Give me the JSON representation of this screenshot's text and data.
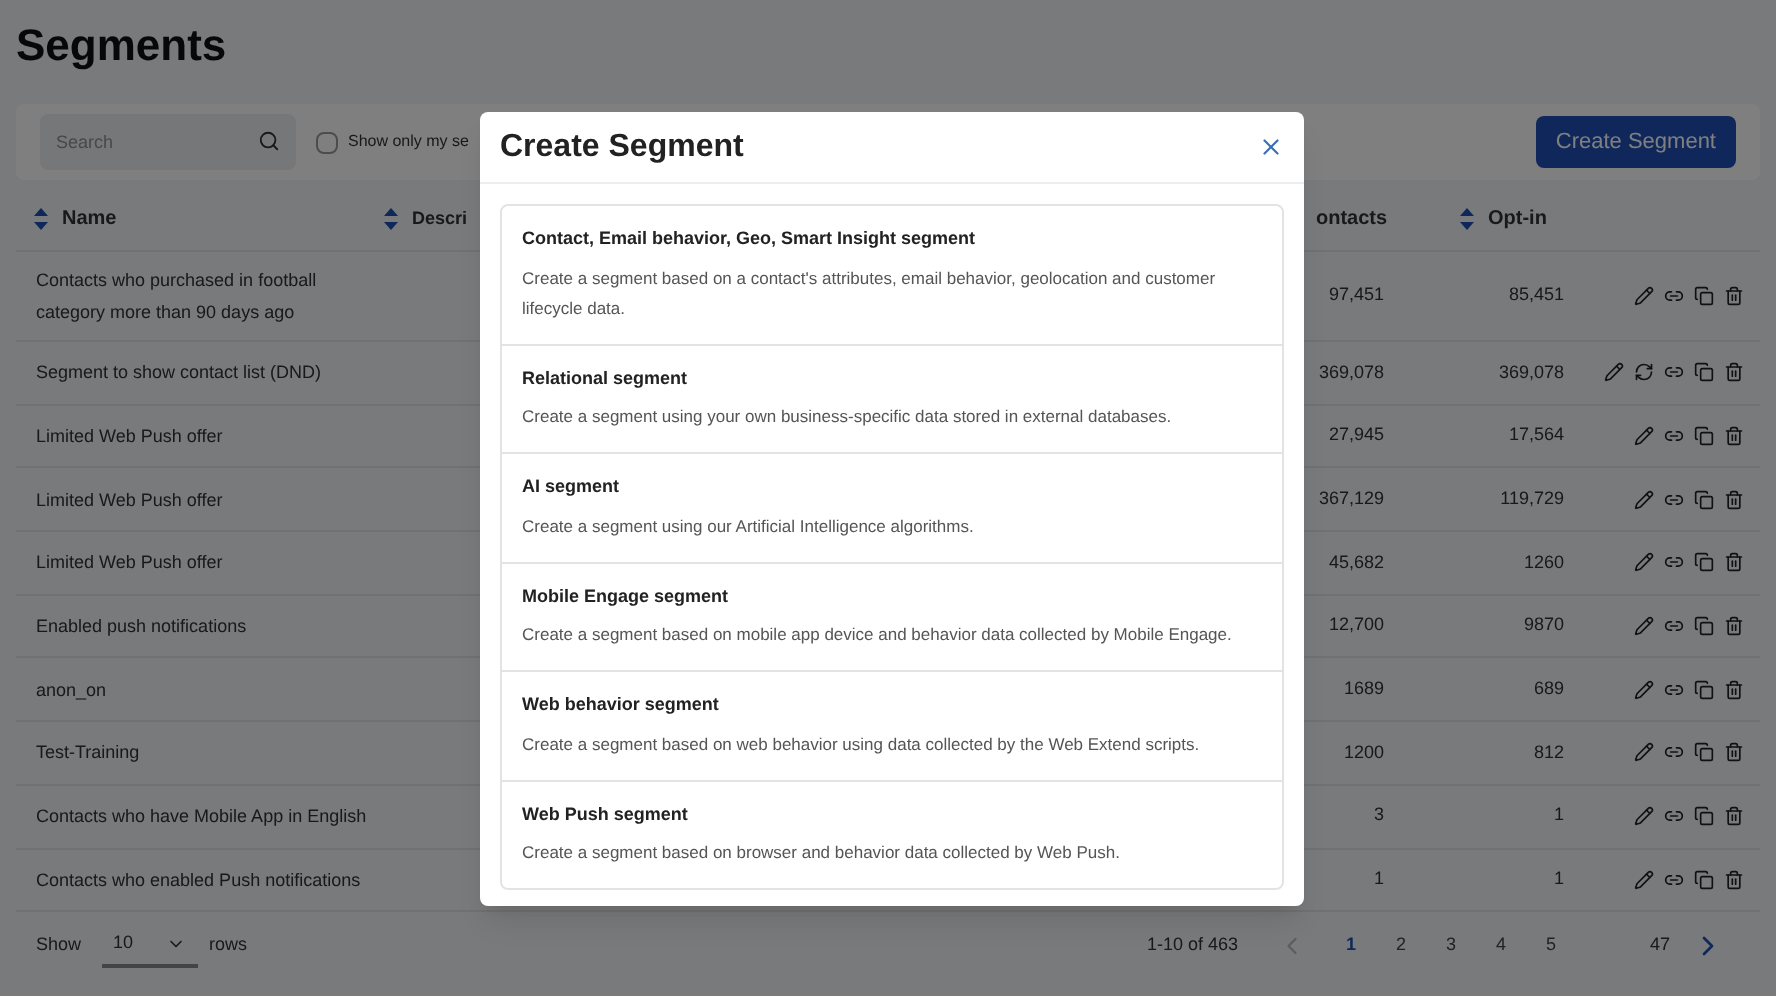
{
  "page": {
    "title": "Segments"
  },
  "toolbar": {
    "search": {
      "placeholder": "Search"
    },
    "filter": {
      "label": "Show only my se",
      "checked": false
    },
    "create_button": "Create Segment"
  },
  "table": {
    "columns": [
      {
        "label": "Name",
        "sortable": true
      },
      {
        "label": "Descri",
        "sortable": true
      },
      {
        "label": "ontacts"
      },
      {
        "label": "Opt-in",
        "sortable": true
      }
    ],
    "rows": [
      {
        "name": "Contacts who purchased in football category more than 90 days ago",
        "contacts": "97,451",
        "opt_in": "85,451",
        "refreshable": false
      },
      {
        "name": "Segment to show contact list (DND)",
        "contacts": "369,078",
        "opt_in": "369,078",
        "refreshable": true
      },
      {
        "name": "Limited Web Push offer",
        "contacts": "27,945",
        "opt_in": "17,564",
        "refreshable": false
      },
      {
        "name": "Limited Web Push offer",
        "contacts": "367,129",
        "opt_in": "119,729",
        "refreshable": false
      },
      {
        "name": "Limited Web Push offer",
        "contacts": "45,682",
        "opt_in": "1260",
        "refreshable": false
      },
      {
        "name": "Enabled push notifications",
        "contacts": "12,700",
        "opt_in": "9870",
        "refreshable": false
      },
      {
        "name": "anon_on",
        "contacts": "1689",
        "opt_in": "689",
        "refreshable": false
      },
      {
        "name": "Test-Training",
        "contacts": "1200",
        "opt_in": "812",
        "refreshable": false
      },
      {
        "name": "Contacts who have Mobile App in English",
        "contacts": "3",
        "opt_in": "1",
        "refreshable": false
      },
      {
        "name": "Contacts who enabled Push notifications",
        "contacts": "1",
        "opt_in": "1",
        "refreshable": false
      }
    ]
  },
  "footer": {
    "show_label": "Show",
    "rows_per_page": "10",
    "rows_label": "rows",
    "range": "1-10 of 463",
    "pages": [
      {
        "label": "1",
        "selected": true
      },
      {
        "label": "2",
        "selected": false
      },
      {
        "label": "3",
        "selected": false
      },
      {
        "label": "4",
        "selected": false
      },
      {
        "label": "5",
        "selected": false
      }
    ],
    "last_page": "47"
  },
  "dialog": {
    "title": "Create Segment",
    "options": [
      {
        "title": "Contact, Email behavior, Geo, Smart Insight segment",
        "description": "Create a segment based on a contact's attributes, email behavior, geolocation and customer lifecycle data."
      },
      {
        "title": "Relational segment",
        "description": "Create a segment using your own business-specific data stored in external databases."
      },
      {
        "title": "AI segment",
        "description": "Create a segment using our Artificial Intelligence algorithms."
      },
      {
        "title": "Mobile Engage segment",
        "description": "Create a segment based on mobile app device and behavior data collected by Mobile Engage."
      },
      {
        "title": "Web behavior segment",
        "description": "Create a segment based on web behavior using data collected by the Web Extend scripts."
      },
      {
        "title": "Web Push segment",
        "description": "Create a segment based on browser and behavior data collected by Web Push."
      }
    ]
  }
}
